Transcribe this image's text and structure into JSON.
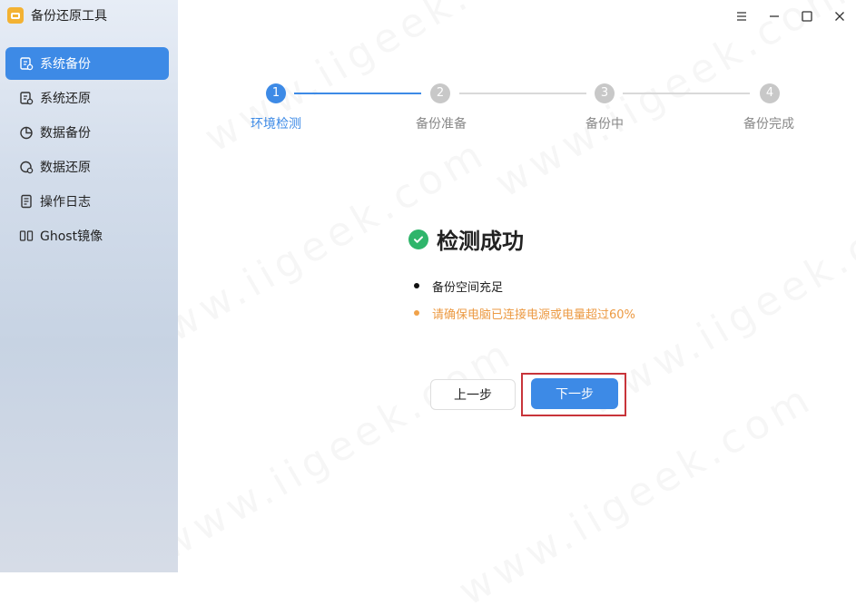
{
  "app": {
    "title": "备份还原工具",
    "logo_icon": "backup-folder-icon"
  },
  "window_controls": [
    {
      "name": "menu-button",
      "icon": "hamburger-icon"
    },
    {
      "name": "minimize-button",
      "icon": "minimize-icon"
    },
    {
      "name": "maximize-button",
      "icon": "maximize-icon"
    },
    {
      "name": "close-button",
      "icon": "close-icon"
    }
  ],
  "sidebar": {
    "items": [
      {
        "label": "系统备份",
        "icon": "system-backup-icon",
        "active": true
      },
      {
        "label": "系统还原",
        "icon": "system-restore-icon",
        "active": false
      },
      {
        "label": "数据备份",
        "icon": "data-backup-icon",
        "active": false
      },
      {
        "label": "数据还原",
        "icon": "data-restore-icon",
        "active": false
      },
      {
        "label": "操作日志",
        "icon": "log-icon",
        "active": false
      },
      {
        "label": "Ghost镜像",
        "icon": "ghost-image-icon",
        "active": false
      }
    ]
  },
  "stepper": {
    "steps": [
      {
        "num": "1",
        "label": "环境检测",
        "status": "active"
      },
      {
        "num": "2",
        "label": "备份准备",
        "status": "todo"
      },
      {
        "num": "3",
        "label": "备份中",
        "status": "todo"
      },
      {
        "num": "4",
        "label": "备份完成",
        "status": "todo"
      }
    ]
  },
  "result": {
    "title": "检测成功",
    "icon": "check-circle-icon",
    "items": [
      {
        "text": "备份空间充足",
        "type": "ok"
      },
      {
        "text": "请确保电脑已连接电源或电量超过60%",
        "type": "warn"
      }
    ]
  },
  "buttons": {
    "prev": "上一步",
    "next": "下一步"
  },
  "colors": {
    "accent": "#3d8ae6",
    "success": "#2fb56b",
    "warning": "#ec9a43",
    "highlight": "#c8343a"
  }
}
